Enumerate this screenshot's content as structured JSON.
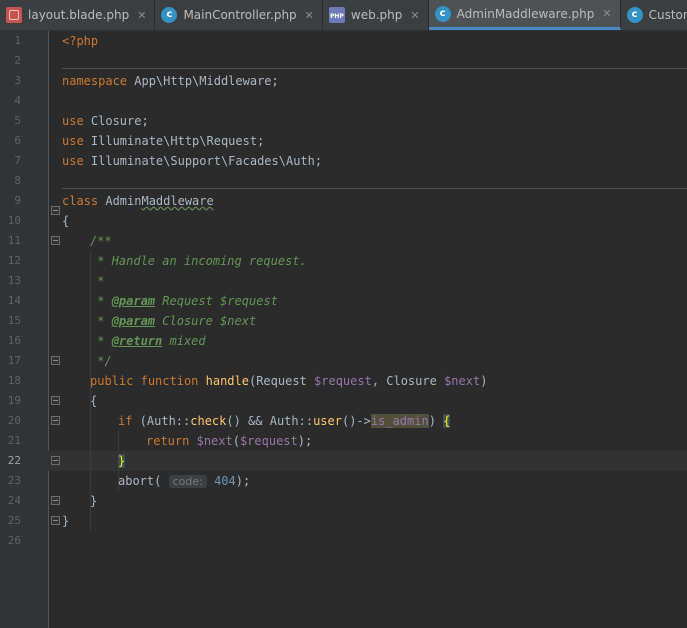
{
  "tabs": [
    {
      "label": "layout.blade.php",
      "icon": "blade-file-icon",
      "active": false
    },
    {
      "label": "MainController.php",
      "icon": "php-class-icon",
      "active": false
    },
    {
      "label": "web.php",
      "icon": "php-file-icon",
      "active": false
    },
    {
      "label": "AdminMaddleware.php",
      "icon": "php-class-icon",
      "active": true
    },
    {
      "label": "CustomCKFinderA",
      "icon": "php-class-icon",
      "active": false
    }
  ],
  "line_numbers": [
    "1",
    "2",
    "3",
    "4",
    "5",
    "6",
    "7",
    "8",
    "9",
    "10",
    "11",
    "12",
    "13",
    "14",
    "15",
    "16",
    "17",
    "18",
    "19",
    "20",
    "21",
    "22",
    "23",
    "24",
    "25",
    "26"
  ],
  "current_line": "22",
  "code": {
    "l1": "<?php",
    "l3_kw": "namespace",
    "l3_rest": " App\\Http\\Middleware;",
    "use": "use",
    "l5_rest": " Closure;",
    "l6_rest": " Illuminate\\Http\\Request;",
    "l7_rest": " Illuminate\\Support\\Facades\\Auth;",
    "l9_kw": "class",
    "l9_name_a": " Admin",
    "l9_name_b": "Maddleware",
    "open_brace": "{",
    "close_brace": "}",
    "l11": "/**",
    "l12": " * Handle an incoming request.",
    "l13": " *",
    "star": " * ",
    "tag_param": "@param",
    "l14_rest": " Request $request",
    "l15_rest": " Closure $next",
    "tag_return": "@return",
    "l16_rest": " mixed",
    "l17": " */",
    "public": "public",
    "function": "function",
    "fn_handle": "handle",
    "l18_a": "(Request ",
    "var_request": "$request",
    "l18_b": ", Closure ",
    "var_next": "$next",
    "paren_close": ")",
    "if": "if",
    "l20_a": " (Auth::",
    "fn_check": "check",
    "l20_b": "() && Auth::",
    "fn_user": "user",
    "l20_c": "()->",
    "prop_is_admin": "is_admin",
    "l20_d": ") ",
    "return": "return",
    "l21_a": "(",
    "l21_b": ");",
    "fn_abort": "abort",
    "hint_code": "code:",
    "num_404": "404",
    "l23_end": ");"
  }
}
